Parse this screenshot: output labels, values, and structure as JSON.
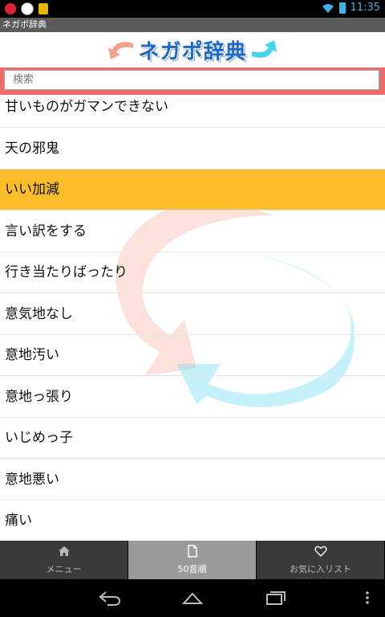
{
  "status_bar": {
    "time": "11:35"
  },
  "app": {
    "title": "ネガポ辞典",
    "logo_text": "ネガポ辞典"
  },
  "search": {
    "placeholder": "検索"
  },
  "list": {
    "items": [
      {
        "label": "甘いものがガマンできない",
        "selected": false
      },
      {
        "label": "天の邪鬼",
        "selected": false
      },
      {
        "label": "いい加減",
        "selected": true
      },
      {
        "label": "言い訳をする",
        "selected": false
      },
      {
        "label": "行き当たりばったり",
        "selected": false
      },
      {
        "label": "意気地なし",
        "selected": false
      },
      {
        "label": "意地汚い",
        "selected": false
      },
      {
        "label": "意地っ張り",
        "selected": false
      },
      {
        "label": "いじめっ子",
        "selected": false
      },
      {
        "label": "意地悪い",
        "selected": false
      },
      {
        "label": "痛い",
        "selected": false
      }
    ]
  },
  "tabs": [
    {
      "label": "メニュー",
      "icon": "home-icon",
      "active": false
    },
    {
      "label": "50音順",
      "icon": "document-icon",
      "active": true
    },
    {
      "label": "お気に入リスト",
      "icon": "heart-icon",
      "active": false
    }
  ],
  "colors": {
    "selected_row": "#fbbd2a",
    "search_band": "#f06c6c",
    "logo_blue": "#1e69c8",
    "arrow_red": "#f7a08c",
    "arrow_cyan": "#40d4f0"
  }
}
